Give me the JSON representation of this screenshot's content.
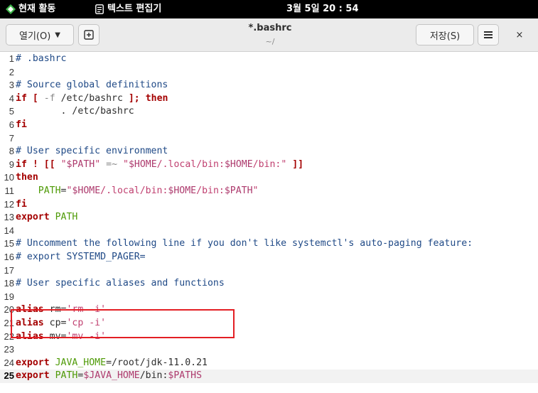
{
  "topbar": {
    "activities": "현재 활동",
    "app_name": "텍스트 편집기",
    "clock": "3월 5일  20 : 54"
  },
  "header": {
    "open_label": "열기(O)",
    "title": "*.bashrc",
    "subtitle": "~/",
    "save_label": "저장(S)",
    "menu_icon": "≡",
    "close_icon": "×",
    "new_tab_icon": "⊞"
  },
  "editor": {
    "current_line": 25,
    "lines": [
      {
        "n": "1",
        "tokens": [
          [
            "cm",
            "# .bashrc"
          ]
        ]
      },
      {
        "n": "2",
        "tokens": []
      },
      {
        "n": "3",
        "tokens": [
          [
            "cm",
            "# Source global definitions"
          ]
        ]
      },
      {
        "n": "4",
        "tokens": [
          [
            "kw",
            "if"
          ],
          [
            "ident",
            " "
          ],
          [
            "kw",
            "["
          ],
          [
            "ident",
            " "
          ],
          [
            "op",
            "-f"
          ],
          [
            "ident",
            " /etc/bashrc "
          ],
          [
            "kw",
            "];"
          ],
          [
            "ident",
            " "
          ],
          [
            "kw",
            "then"
          ]
        ]
      },
      {
        "n": "5",
        "tokens": [
          [
            "ident",
            "        . /etc/bashrc"
          ]
        ]
      },
      {
        "n": "6",
        "tokens": [
          [
            "kw",
            "fi"
          ]
        ]
      },
      {
        "n": "7",
        "tokens": []
      },
      {
        "n": "8",
        "tokens": [
          [
            "cm",
            "# User specific environment"
          ]
        ]
      },
      {
        "n": "9",
        "tokens": [
          [
            "kw",
            "if"
          ],
          [
            "ident",
            " "
          ],
          [
            "kw",
            "!"
          ],
          [
            "ident",
            " "
          ],
          [
            "kw",
            "[["
          ],
          [
            "ident",
            " "
          ],
          [
            "str",
            "\""
          ],
          [
            "var",
            "$PATH"
          ],
          [
            "str",
            "\""
          ],
          [
            "ident",
            " "
          ],
          [
            "op",
            "=~"
          ],
          [
            "ident",
            " "
          ],
          [
            "str",
            "\""
          ],
          [
            "var",
            "$HOME"
          ],
          [
            "str",
            "/.local/bin:"
          ],
          [
            "var",
            "$HOME"
          ],
          [
            "str",
            "/bin:\""
          ],
          [
            "ident",
            " "
          ],
          [
            "kw",
            "]]"
          ]
        ]
      },
      {
        "n": "10",
        "tokens": [
          [
            "kw",
            "then"
          ]
        ]
      },
      {
        "n": "11",
        "tokens": [
          [
            "ident",
            "    "
          ],
          [
            "grn",
            "PATH"
          ],
          [
            "ident",
            "="
          ],
          [
            "str",
            "\""
          ],
          [
            "var",
            "$HOME"
          ],
          [
            "str",
            "/.local/bin:"
          ],
          [
            "var",
            "$HOME"
          ],
          [
            "str",
            "/bin:"
          ],
          [
            "var",
            "$PATH"
          ],
          [
            "str",
            "\""
          ]
        ]
      },
      {
        "n": "12",
        "tokens": [
          [
            "kw",
            "fi"
          ]
        ]
      },
      {
        "n": "13",
        "tokens": [
          [
            "kw",
            "export"
          ],
          [
            "ident",
            " "
          ],
          [
            "grn",
            "PATH"
          ]
        ]
      },
      {
        "n": "14",
        "tokens": []
      },
      {
        "n": "15",
        "tokens": [
          [
            "cm",
            "# Uncomment the following line if you don't like systemctl's auto-paging feature:"
          ]
        ]
      },
      {
        "n": "16",
        "tokens": [
          [
            "cm",
            "# export SYSTEMD_PAGER="
          ]
        ]
      },
      {
        "n": "17",
        "tokens": []
      },
      {
        "n": "18",
        "tokens": [
          [
            "cm",
            "# User specific aliases and functions"
          ]
        ]
      },
      {
        "n": "19",
        "tokens": []
      },
      {
        "n": "20",
        "tokens": [
          [
            "kw",
            "alias"
          ],
          [
            "ident",
            " rm="
          ],
          [
            "rm",
            "'rm -i'"
          ]
        ]
      },
      {
        "n": "21",
        "tokens": [
          [
            "kw",
            "alias"
          ],
          [
            "ident",
            " cp="
          ],
          [
            "rm",
            "'cp -i'"
          ]
        ]
      },
      {
        "n": "22",
        "tokens": [
          [
            "kw",
            "alias"
          ],
          [
            "ident",
            " mv="
          ],
          [
            "rm",
            "'mv -i'"
          ]
        ]
      },
      {
        "n": "23",
        "tokens": []
      },
      {
        "n": "24",
        "tokens": [
          [
            "kw",
            "export"
          ],
          [
            "ident",
            " "
          ],
          [
            "grn",
            "JAVA_HOME"
          ],
          [
            "ident",
            "=/root/jdk-11.0.21"
          ]
        ]
      },
      {
        "n": "25",
        "tokens": [
          [
            "kw",
            "export"
          ],
          [
            "ident",
            " "
          ],
          [
            "grn",
            "PATH"
          ],
          [
            "ident",
            "="
          ],
          [
            "var",
            "$JAVA_HOME"
          ],
          [
            "ident",
            "/bin:"
          ],
          [
            "var",
            "$PATHS"
          ]
        ]
      }
    ]
  },
  "colors": {
    "keyword": "#a40000",
    "comment": "#204a87",
    "string": "#c04070",
    "variable_name": "#4e9a06",
    "highlight_box": "#e31e24"
  }
}
